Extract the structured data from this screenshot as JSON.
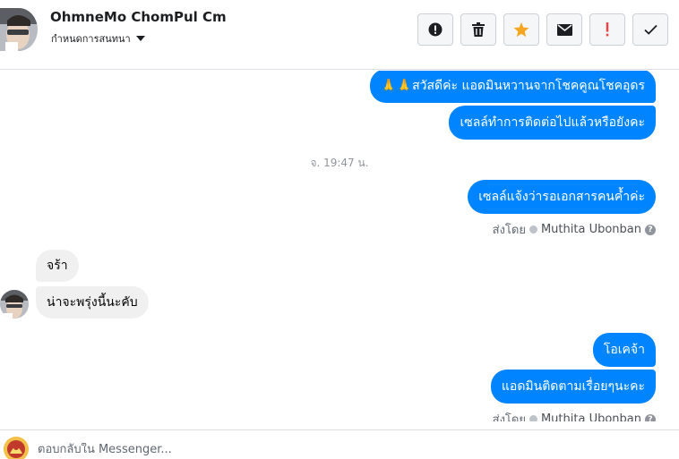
{
  "header": {
    "contact_name": "OhmneMo ChomPul Cm",
    "conversation_settings_label": "กำหนดการสนทนา",
    "actions": [
      {
        "name": "mark-spam",
        "icon": "alert-circle-icon"
      },
      {
        "name": "delete",
        "icon": "trash-icon"
      },
      {
        "name": "star",
        "icon": "star-icon",
        "color": "#f5a623"
      },
      {
        "name": "mark-unread",
        "icon": "envelope-icon"
      },
      {
        "name": "follow-up",
        "icon": "exclamation-icon",
        "color": "#fa3e3e"
      },
      {
        "name": "mark-done",
        "icon": "checkmark-icon"
      }
    ]
  },
  "thread": {
    "messages": [
      {
        "direction": "out",
        "text": "🙏🙏สวัสดีค่ะ แอดมินหวานจากโชคคูณโชคอุดร"
      },
      {
        "direction": "out",
        "text": "เซลล์ทำการติดต่อไปแล้วหรือยังคะ"
      },
      {
        "direction": "timestamp",
        "text": "จ. 19:47 น."
      },
      {
        "direction": "out",
        "text": "เซลล์แจ้งว่ารอเอกสารคนค้ำค่ะ"
      },
      {
        "direction": "sent_by",
        "prefix": "ส่งโดย",
        "agent": "Muthita Ubonban"
      },
      {
        "direction": "in",
        "text": "จร้า"
      },
      {
        "direction": "in",
        "text": "น่าจะพรุ่งนี้นะคับ"
      },
      {
        "direction": "out",
        "text": "โอเคจ้า"
      },
      {
        "direction": "out",
        "text": "แอดมินติดตามเรื่อยๆนะคะ"
      },
      {
        "direction": "sent_by",
        "prefix": "ส่งโดย",
        "agent": "Muthita Ubonban"
      }
    ]
  },
  "composer": {
    "placeholder": "ตอบกลับใน Messenger..."
  },
  "colors": {
    "outgoing_bubble": "#0084ff",
    "incoming_bubble": "#f1f0f0"
  }
}
